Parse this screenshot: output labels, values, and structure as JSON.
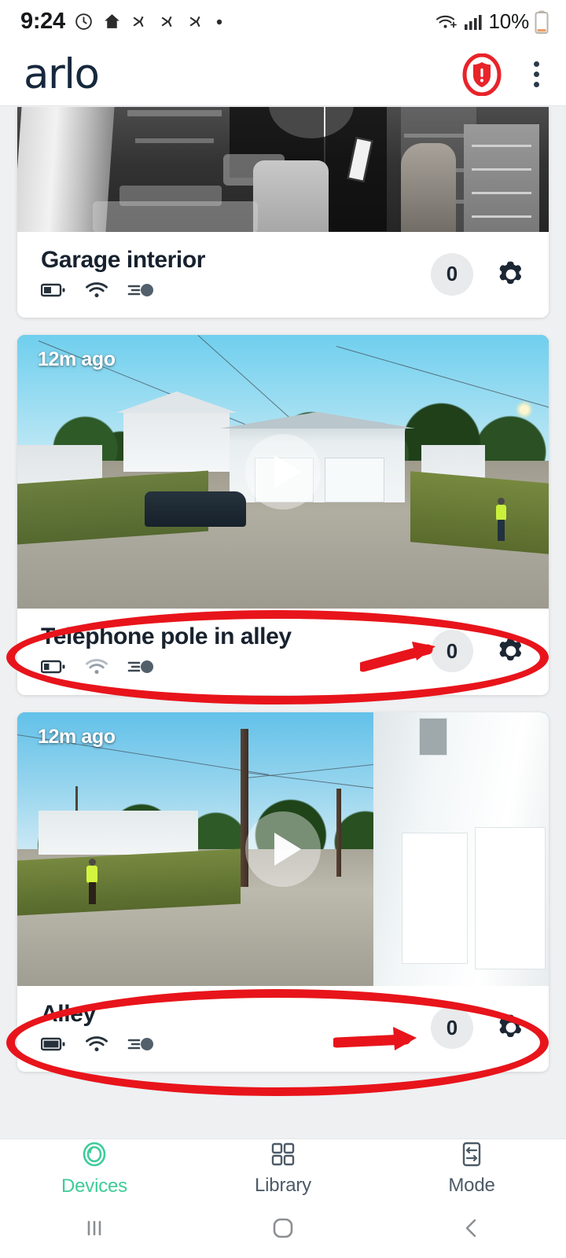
{
  "status_bar": {
    "time": "9:24",
    "battery_percent": "10%",
    "left_icons": [
      "alarm-icon",
      "home-icon",
      "mute-vibrate-icon",
      "mute-vibrate-icon",
      "mute-vibrate-icon",
      "dot-indicator-icon"
    ],
    "right_icons": [
      "wifi-calling-icon",
      "cellular-signal-icon",
      "battery-icon"
    ]
  },
  "header": {
    "brand": "arlo",
    "alert_icon": "shield-alert-icon",
    "alert_color": "#e8232a",
    "menu_icon": "overflow-menu-icon"
  },
  "devices": [
    {
      "name": "Garage interior",
      "timestamp": "",
      "count": "0",
      "battery_level": "medium",
      "wifi_state": "strong",
      "motion_icon": "motion-detection-icon",
      "settings_icon": "gear-icon",
      "thumbnail_clipped": true,
      "scene": "garage-night-vision"
    },
    {
      "name": "Telephone pole in alley",
      "timestamp": "12m ago",
      "count": "0",
      "battery_level": "low",
      "wifi_state": "weak",
      "motion_icon": "motion-detection-icon",
      "settings_icon": "gear-icon",
      "thumbnail_clipped": false,
      "scene": "alley-garages"
    },
    {
      "name": "Alley",
      "timestamp": "12m ago",
      "count": "0",
      "battery_level": "full",
      "wifi_state": "strong",
      "motion_icon": "motion-detection-icon",
      "settings_icon": "gear-icon",
      "thumbnail_clipped": false,
      "scene": "alley-pole"
    }
  ],
  "annotations": {
    "highlight_color": "#e8141b",
    "shapes": [
      "ellipse-around-telephone-pole-row",
      "arrow-to-telephone-pole-count",
      "ellipse-around-alley-row",
      "arrow-to-alley-count"
    ]
  },
  "bottom_nav": {
    "active": "Devices",
    "active_color": "#3fcc9a",
    "items": [
      {
        "label": "Devices",
        "icon": "camera-lens-icon"
      },
      {
        "label": "Library",
        "icon": "grid-icon"
      },
      {
        "label": "Mode",
        "icon": "mode-sliders-icon"
      }
    ]
  },
  "system_nav": {
    "recents": "recents-icon",
    "home": "home-circle-icon",
    "back": "back-chevron-icon"
  }
}
